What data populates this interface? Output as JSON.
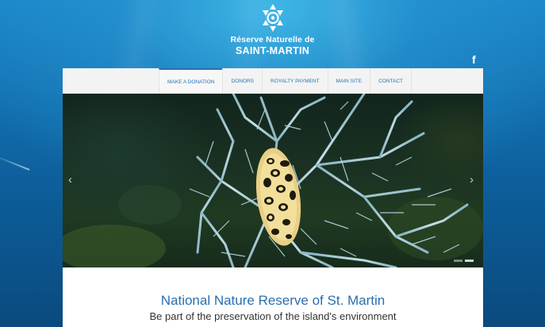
{
  "logo": {
    "line1": "Réserve Naturelle de",
    "line2": "SAINT-MARTIN",
    "icon": "snowflake-star-icon"
  },
  "social": {
    "facebook_icon": "facebook-icon",
    "facebook_glyph": "f"
  },
  "nav": {
    "items": [
      {
        "label": "MAKE A DONATION",
        "active": true
      },
      {
        "label": "DONORS",
        "active": false
      },
      {
        "label": "ROYALTY PAYMENT",
        "active": false
      },
      {
        "label": "MAIN SITE",
        "active": false
      },
      {
        "label": "CONTACT",
        "active": false
      }
    ]
  },
  "slider": {
    "prev_glyph": "‹",
    "next_glyph": "›",
    "slides_count": 2,
    "active_slide": 1
  },
  "content": {
    "title": "National Nature Reserve of St. Martin",
    "subtitle": "Be part of the preservation of the island's environment"
  },
  "colors": {
    "accent": "#2a6fb0",
    "nav_bg": "#f3f3f3",
    "ocean_top": "#3fb6e6",
    "ocean_bottom": "#0a4a7e"
  }
}
